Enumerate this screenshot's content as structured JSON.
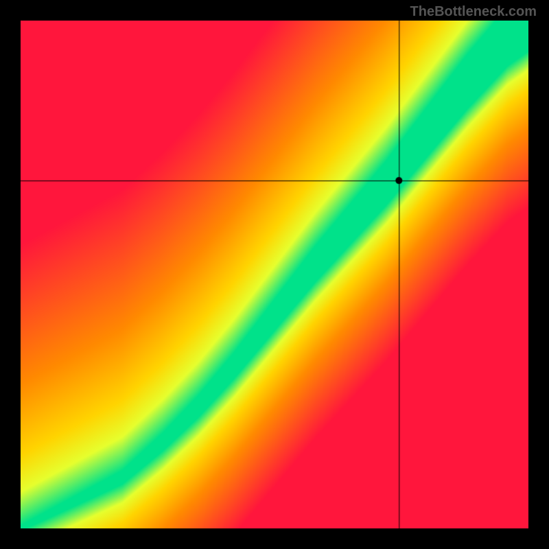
{
  "watermark": "TheBottleneck.com",
  "chart_data": {
    "type": "heatmap",
    "title": "",
    "description": "Bottleneck compatibility heatmap with diagonal optimal band",
    "canvas_size": 740,
    "crosshair": {
      "x_frac": 0.745,
      "y_frac": 0.315
    },
    "marker": {
      "x_frac": 0.745,
      "y_frac": 0.315,
      "radius": 5
    },
    "optimal_curve": {
      "comment": "fractional (x,y) points along the green band, origin = top-left of plot area",
      "points": [
        {
          "x": 0.0,
          "y": 1.0
        },
        {
          "x": 0.1,
          "y": 0.95
        },
        {
          "x": 0.2,
          "y": 0.9
        },
        {
          "x": 0.28,
          "y": 0.83
        },
        {
          "x": 0.35,
          "y": 0.76
        },
        {
          "x": 0.42,
          "y": 0.68
        },
        {
          "x": 0.5,
          "y": 0.58
        },
        {
          "x": 0.58,
          "y": 0.48
        },
        {
          "x": 0.65,
          "y": 0.4
        },
        {
          "x": 0.72,
          "y": 0.32
        },
        {
          "x": 0.8,
          "y": 0.22
        },
        {
          "x": 0.88,
          "y": 0.12
        },
        {
          "x": 0.96,
          "y": 0.03
        },
        {
          "x": 1.0,
          "y": 0.0
        }
      ]
    },
    "band_width_frac": {
      "start": 0.01,
      "end": 0.12
    },
    "colors": {
      "best": "#00e28a",
      "good": "#e6ff2e",
      "mid": "#ffd400",
      "warm": "#ff8a00",
      "bad": "#ff163c"
    },
    "xlabel": "",
    "ylabel": "",
    "xlim": [
      0,
      1
    ],
    "ylim": [
      0,
      1
    ]
  }
}
